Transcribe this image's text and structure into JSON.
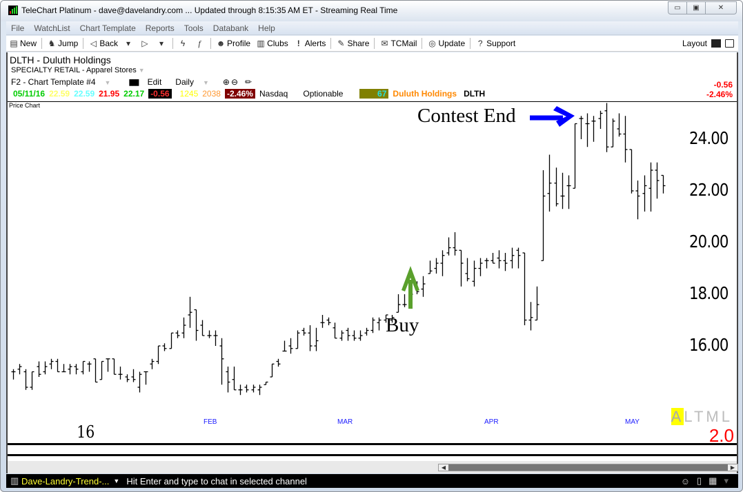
{
  "window": {
    "title": "TeleChart Platinum - dave@davelandry.com  ... Updated through 8:15:35 AM ET  -  Streaming Real Time",
    "minimize_icon": "minimize-icon",
    "maximize_icon": "maximize-icon",
    "close_icon": "close-icon"
  },
  "menu": [
    "File",
    "WatchList",
    "Chart Template",
    "Reports",
    "Tools",
    "Databank",
    "Help"
  ],
  "toolbar": {
    "new": "New",
    "jump": "Jump",
    "back": "Back",
    "profile": "Profile",
    "clubs": "Clubs",
    "alerts": "Alerts",
    "share": "Share",
    "tcmail": "TCMail",
    "update": "Update",
    "support": "Support",
    "layout": "Layout"
  },
  "symbol": {
    "title": "DLTH  -  Duluth Holdings",
    "sector": "SPECIALTY RETAIL - Apparel Stores",
    "template": "F2 - Chart Template #4",
    "edit": "Edit",
    "period": "Daily"
  },
  "quote": {
    "date": "05/11/16",
    "open": "22.59",
    "high": "22.59",
    "low": "21.95",
    "close": "22.17",
    "change": "-0.56",
    "volume": "1245",
    "avg_volume": "2038",
    "change_pct": "-2.46%",
    "exchange": "Nasdaq",
    "optionable": "Optionable",
    "rank": "67",
    "company": "Duluth Holdings",
    "ticker": "DLTH"
  },
  "right_change": {
    "change": "-0.56",
    "pct": "-2.46%"
  },
  "colors": {
    "date": "#00cc00",
    "open": "#ffff66",
    "high": "#66ffff",
    "low": "#ff0000",
    "close": "#00cc00",
    "volume": "#ffff00",
    "avg_volume": "#ff9933",
    "change_bg": "#000000",
    "change_pct_bg": "#800000",
    "company": "#ff8800",
    "buy_arrow": "#5aa02c",
    "contest_arrow": "#0000ff"
  },
  "pane_label": "Price Chart",
  "annotations": {
    "contest_end": "Contest End",
    "buy": "Buy"
  },
  "footer": {
    "year": "16",
    "altml": [
      "A",
      "L",
      "T",
      "M",
      "L"
    ],
    "ratio": "2.0"
  },
  "statusbar": {
    "channel": "Dave-Landry-Trend-...",
    "hint": "Hit Enter and type to chat in selected channel"
  },
  "chart_data": {
    "type": "ohlc",
    "title": "DLTH - Duluth Holdings",
    "xlabel": "",
    "ylabel": "Price",
    "ylim": [
      13.5,
      25.3
    ],
    "yticks": [
      "24.00",
      "22.00",
      "20.00",
      "18.00",
      "16.00"
    ],
    "ytick_values": [
      24,
      22,
      20,
      18,
      16
    ],
    "month_labels": [
      {
        "label": "FEB",
        "bar": 30
      },
      {
        "label": "MAR",
        "bar": 50
      },
      {
        "label": "APR",
        "bar": 72
      },
      {
        "label": "MAY",
        "bar": 93
      }
    ],
    "bars": [
      [
        15.0,
        15.1,
        14.7,
        15.0
      ],
      [
        15.1,
        15.3,
        14.9,
        15.2
      ],
      [
        15.0,
        15.1,
        14.3,
        14.4
      ],
      [
        14.4,
        15.0,
        14.3,
        15.0
      ],
      [
        15.2,
        15.4,
        14.8,
        14.9
      ],
      [
        15.0,
        15.4,
        14.9,
        15.2
      ],
      [
        15.3,
        15.5,
        15.1,
        15.4
      ],
      [
        15.4,
        15.5,
        15.0,
        15.0
      ],
      [
        15.0,
        15.3,
        15.0,
        15.0
      ],
      [
        15.1,
        15.3,
        14.9,
        15.2
      ],
      [
        15.2,
        15.3,
        14.9,
        15.1
      ],
      [
        15.0,
        15.4,
        14.9,
        15.4
      ],
      [
        15.3,
        15.4,
        15.0,
        15.3
      ],
      [
        15.5,
        15.5,
        14.6,
        14.6
      ],
      [
        14.7,
        15.4,
        14.7,
        15.4
      ],
      [
        15.5,
        15.5,
        15.0,
        15.5
      ],
      [
        15.5,
        15.5,
        14.9,
        14.9
      ],
      [
        14.9,
        15.2,
        14.7,
        14.9
      ],
      [
        14.8,
        14.9,
        14.6,
        14.7
      ],
      [
        14.8,
        15.1,
        14.6,
        14.7
      ],
      [
        14.4,
        15.0,
        14.2,
        14.9
      ],
      [
        15.0,
        15.0,
        14.5,
        15.0
      ],
      [
        15.3,
        15.5,
        15.1,
        15.4
      ],
      [
        15.4,
        16.0,
        15.3,
        16.0
      ],
      [
        16.0,
        16.1,
        15.8,
        15.9
      ],
      [
        15.9,
        16.5,
        15.9,
        16.5
      ],
      [
        16.5,
        16.6,
        16.3,
        16.4
      ],
      [
        16.5,
        17.1,
        16.3,
        16.8
      ],
      [
        17.2,
        17.9,
        16.7,
        17.3
      ],
      [
        17.4,
        17.1,
        16.2,
        16.6
      ],
      [
        16.8,
        17.0,
        16.4,
        16.4
      ],
      [
        16.4,
        16.6,
        16.3,
        16.4
      ],
      [
        16.4,
        16.6,
        16.0,
        16.4
      ],
      [
        16.0,
        16.3,
        14.5,
        15.5
      ],
      [
        15.0,
        15.2,
        14.2,
        14.6
      ],
      [
        14.7,
        15.2,
        14.3,
        14.3
      ],
      [
        14.3,
        14.5,
        14.1,
        14.3
      ],
      [
        14.4,
        14.5,
        14.2,
        14.3
      ],
      [
        14.3,
        14.5,
        14.2,
        14.4
      ],
      [
        14.3,
        14.5,
        14.1,
        14.4
      ],
      [
        14.5,
        14.6,
        14.5,
        14.6
      ],
      [
        14.8,
        15.3,
        14.8,
        15.3
      ],
      [
        15.4,
        15.5,
        15.2,
        15.3
      ],
      [
        15.8,
        16.2,
        15.8,
        15.8
      ],
      [
        16.0,
        16.3,
        15.7,
        15.9
      ],
      [
        15.9,
        16.6,
        15.9,
        16.5
      ],
      [
        16.6,
        16.7,
        16.4,
        16.5
      ],
      [
        16.5,
        16.8,
        15.8,
        16.0
      ],
      [
        16.0,
        16.7,
        15.8,
        16.2
      ],
      [
        16.9,
        17.2,
        16.7,
        16.9
      ],
      [
        17.0,
        17.1,
        16.8,
        16.9
      ],
      [
        16.7,
        16.9,
        16.3,
        16.3
      ],
      [
        16.3,
        16.6,
        16.2,
        16.5
      ],
      [
        16.6,
        16.7,
        16.2,
        16.4
      ],
      [
        16.4,
        16.6,
        16.2,
        16.3
      ],
      [
        16.3,
        16.6,
        16.2,
        16.4
      ],
      [
        16.5,
        16.7,
        16.4,
        16.6
      ],
      [
        16.6,
        17.1,
        16.5,
        17.0
      ],
      [
        16.9,
        17.1,
        16.6,
        17.0
      ],
      [
        17.0,
        17.2,
        16.9,
        17.2
      ],
      [
        17.0,
        17.2,
        16.9,
        17.1
      ],
      [
        17.3,
        18.0,
        17.3,
        17.6
      ],
      [
        17.6,
        18.0,
        17.5,
        17.6
      ],
      [
        17.6,
        18.3,
        17.8,
        18.0
      ],
      [
        18.2,
        18.5,
        18.0,
        18.1
      ],
      [
        18.2,
        18.7,
        17.9,
        18.4
      ],
      [
        18.8,
        19.3,
        18.8,
        18.9
      ],
      [
        19.0,
        19.4,
        18.8,
        19.2
      ],
      [
        19.2,
        19.7,
        18.7,
        19.5
      ],
      [
        19.6,
        20.2,
        19.5,
        19.8
      ],
      [
        19.8,
        20.4,
        19.5,
        19.7
      ],
      [
        19.7,
        19.5,
        18.3,
        19.2
      ],
      [
        18.8,
        19.4,
        18.5,
        18.6
      ],
      [
        18.5,
        19.3,
        18.3,
        19.0
      ],
      [
        19.0,
        19.4,
        18.7,
        19.2
      ],
      [
        19.3,
        19.4,
        19.0,
        19.3
      ],
      [
        19.3,
        19.6,
        19.2,
        19.2
      ],
      [
        19.4,
        19.7,
        19.0,
        19.3
      ],
      [
        19.3,
        19.6,
        18.9,
        19.2
      ],
      [
        19.3,
        19.8,
        19.0,
        19.5
      ],
      [
        19.7,
        19.8,
        19.0,
        19.5
      ],
      [
        19.6,
        19.6,
        16.8,
        17.0
      ],
      [
        17.0,
        17.7,
        16.6,
        17.1
      ],
      [
        17.0,
        18.3,
        17.0,
        17.6
      ],
      [
        19.3,
        22.8,
        19.3,
        21.8
      ],
      [
        21.9,
        23.4,
        21.2,
        22.3
      ],
      [
        22.3,
        22.9,
        21.4,
        21.5
      ],
      [
        21.8,
        22.7,
        21.3,
        21.8
      ],
      [
        22.2,
        22.6,
        21.3,
        22.2
      ],
      [
        22.1,
        24.3,
        22.1,
        24.6
      ],
      [
        24.8,
        24.9,
        24.0,
        24.8
      ],
      [
        24.6,
        25.0,
        23.7,
        24.6
      ],
      [
        24.7,
        24.9,
        23.9,
        24.7
      ],
      [
        24.8,
        25.1,
        24.4,
        25.0
      ],
      [
        25.1,
        25.4,
        23.5,
        23.7
      ],
      [
        23.7,
        24.8,
        23.7,
        24.7
      ],
      [
        24.4,
        25.0,
        24.1,
        24.2
      ],
      [
        24.2,
        24.9,
        23.1,
        23.6
      ],
      [
        23.6,
        23.2,
        21.9,
        22.0
      ],
      [
        22.0,
        22.4,
        20.9,
        21.8
      ],
      [
        21.9,
        22.6,
        21.2,
        22.2
      ],
      [
        22.1,
        23.1,
        21.2,
        22.8
      ],
      [
        22.8,
        23.1,
        21.7,
        22.4
      ],
      [
        22.6,
        22.6,
        21.9,
        22.2
      ]
    ]
  }
}
